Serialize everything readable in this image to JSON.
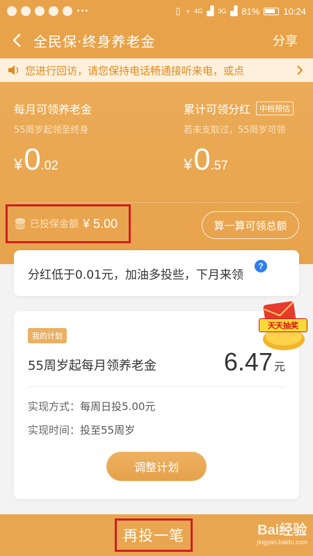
{
  "status": {
    "dots": "···",
    "network_a": "4G",
    "network_b": "3G",
    "battery": "81%",
    "time": "10:24"
  },
  "nav": {
    "title": "全民保·终身养老金",
    "share": "分享"
  },
  "notice": {
    "text": "您进行回访，请您保持电话畅通接听来电，或点"
  },
  "hero": {
    "monthly": {
      "label": "每月可领养老金",
      "sub": "55周岁起领至终身",
      "currency": "¥",
      "int": "0",
      "dec": ".02"
    },
    "dividend": {
      "label": "累计可领分红",
      "tag": "中档预估",
      "sub": "若未支取过，55周岁可领",
      "currency": "¥",
      "int": "0",
      "dec": ".57"
    },
    "invested": {
      "label": "已投保金额",
      "value": "¥ 5.00"
    },
    "calc_button": "算一算可领总额"
  },
  "tip": {
    "text": "分红低于0.01元，加油多投些，下月来领",
    "help": "?"
  },
  "lottery": {
    "text": "天天抽奖"
  },
  "plan": {
    "tag": "我的计划",
    "name": "55周岁起每月领养老金",
    "amount": "6.47",
    "unit": "元",
    "method_label": "实现方式：",
    "method_value": "每周日投5.00元",
    "time_label": "实现时间：",
    "time_value": "投至55周岁",
    "adjust_button": "调整计划"
  },
  "bottom": {
    "invest_again": "再投一笔",
    "watermark_logo": "Bai经验",
    "watermark_url": "jingyan.baidu.com"
  },
  "colors": {
    "brand": "#e9a650",
    "highlight_box": "#cc1f1f",
    "notice_bg": "#fdf0dc",
    "help_blue": "#2d7ef0"
  }
}
